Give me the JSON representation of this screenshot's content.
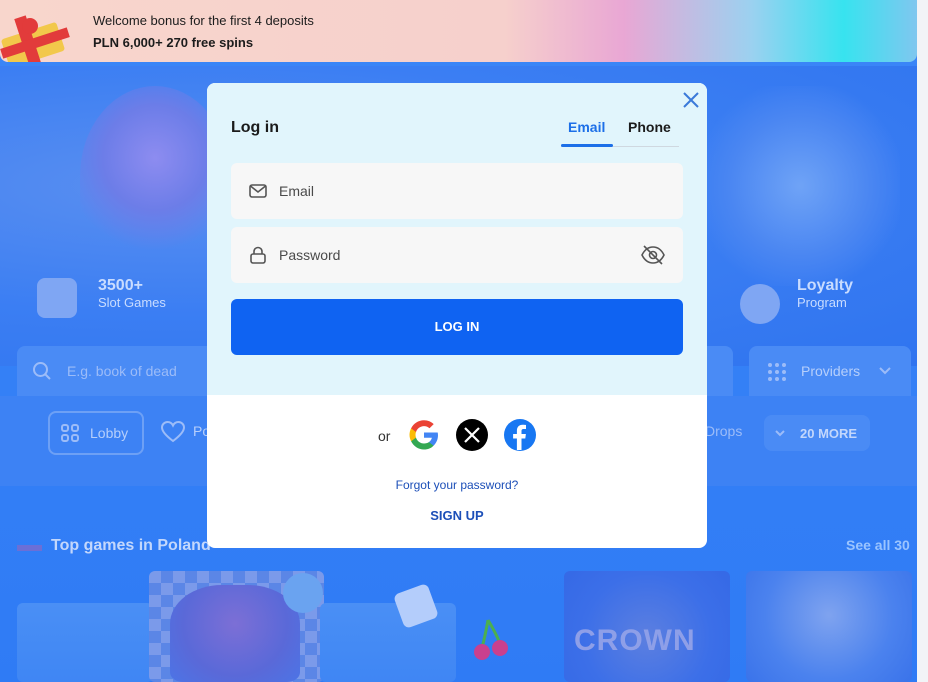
{
  "promo": {
    "line1": "Welcome bonus for the first 4 deposits",
    "line2": "PLN 6,000+ 270 free spins"
  },
  "hero": {
    "stat1_big": "3500+",
    "stat1_small": "Slot Games",
    "stat2_big": "Loyalty",
    "stat2_small": "Program"
  },
  "search": {
    "placeholder": "E.g. book of dead"
  },
  "providers": {
    "label": "Providers"
  },
  "filters": {
    "lobby": "Lobby",
    "partial": "Po",
    "drops": "Drops",
    "more": "20 MORE"
  },
  "section": {
    "title": "Top games in Poland",
    "see_all": "See all 30"
  },
  "tiles": {
    "crown": "CROWN"
  },
  "modal": {
    "title": "Log in",
    "tabs": [
      {
        "label": "Email",
        "active": true
      },
      {
        "label": "Phone",
        "active": false
      }
    ],
    "email_placeholder": "Email",
    "password_placeholder": "Password",
    "login_button": "LOG IN",
    "or_label": "or",
    "forgot": "Forgot your password?",
    "signup": "SIGN UP"
  },
  "colors": {
    "accent": "#0f63f2",
    "link": "#1c4fb8",
    "modal_top": "#e1f5fc"
  }
}
